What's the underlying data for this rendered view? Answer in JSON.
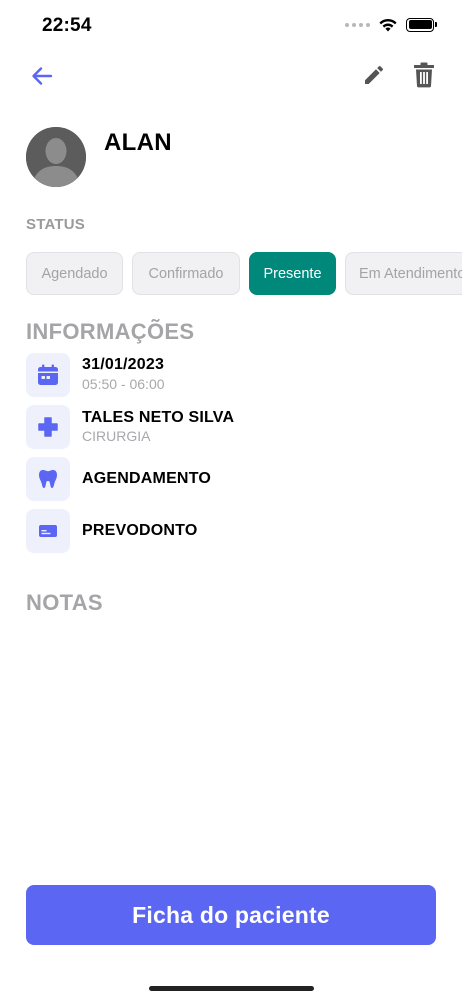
{
  "status_bar": {
    "time": "22:54",
    "icons": [
      "signal-icon",
      "wifi-icon",
      "battery-icon"
    ]
  },
  "toolbar": {
    "icons": [
      "back-arrow-icon",
      "pencil-icon",
      "trash-icon"
    ]
  },
  "patient": {
    "name": "ALAN"
  },
  "status": {
    "label": "STATUS",
    "options": [
      "Agendado",
      "Confirmado",
      "Presente",
      "Em Atendimento"
    ],
    "selected": "Presente"
  },
  "info": {
    "title": "INFORMAÇÕES",
    "items": [
      {
        "icon": "calendar-icon",
        "main": "31/01/2023",
        "sub": "05:50 - 06:00"
      },
      {
        "icon": "medical-cross-icon",
        "main": "TALES NETO SILVA",
        "sub": "CIRURGIA"
      },
      {
        "icon": "tooth-icon",
        "main": "AGENDAMENTO",
        "sub": ""
      },
      {
        "icon": "card-icon",
        "main": "PREVODONTO",
        "sub": ""
      }
    ]
  },
  "notes": {
    "title": "NOTAS"
  },
  "footer": {
    "primary_button": "Ficha do paciente"
  },
  "colors": {
    "accent": "#5b67f2",
    "selected_status": "#00897b",
    "icon_bg": "#eef0fb",
    "muted_text": "#a5a5a8"
  }
}
